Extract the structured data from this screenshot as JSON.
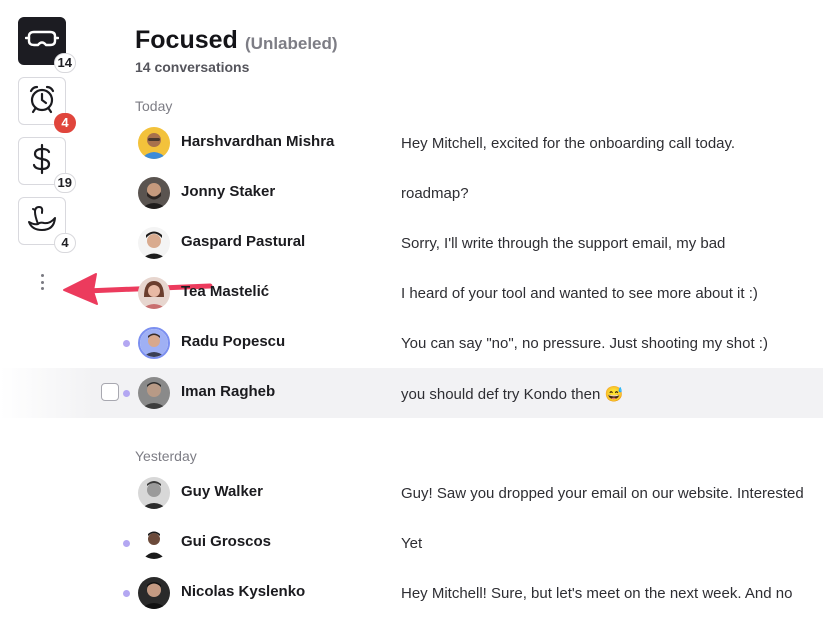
{
  "sidebar": {
    "buttons": [
      {
        "icon": "vr-goggles-icon",
        "badge": "14",
        "active": true
      },
      {
        "icon": "alarm-clock-icon",
        "badge": "4",
        "badge_color": "#e0453c"
      },
      {
        "icon": "dollar-sign-icon",
        "badge": "19"
      },
      {
        "icon": "swan-icon",
        "badge": "4"
      }
    ]
  },
  "header": {
    "title": "Focused",
    "subtitle": "(Unlabeled)",
    "count": "14 conversations"
  },
  "sections": {
    "today": "Today",
    "yesterday": "Yesterday"
  },
  "conversations": [
    {
      "name": "Harshvardhan Mishra",
      "message": "Hey Mitchell, excited for the onboarding call today.",
      "unread": false
    },
    {
      "name": "Jonny Staker",
      "message": "roadmap?",
      "unread": false
    },
    {
      "name": "Gaspard Pastural",
      "message": "Sorry, I'll write through the support email, my bad",
      "unread": false
    },
    {
      "name": "Tea Mastelić",
      "message": "I heard of your tool and wanted to see more about it :)",
      "unread": false
    },
    {
      "name": "Radu Popescu",
      "message": "You can say \"no\", no pressure. Just shooting my shot :)",
      "unread": true
    },
    {
      "name": "Iman Ragheb",
      "message": "you should def try Kondo then 😅",
      "unread": true,
      "hovered": true
    },
    {
      "name": "Guy Walker",
      "message": "Guy! Saw you dropped your email on our website. Interested",
      "unread": false
    },
    {
      "name": "Gui Groscos",
      "message": "Yet",
      "unread": true
    },
    {
      "name": "Nicolas Kyslenko",
      "message": "Hey Mitchell! Sure, but let's meet on the next week. And no",
      "unread": true
    }
  ],
  "colors": {
    "accent_unread": "#b3a7f2",
    "badge_red": "#e0453c",
    "arrow": "#ec3b5d",
    "active_button": "#1c1c22"
  }
}
